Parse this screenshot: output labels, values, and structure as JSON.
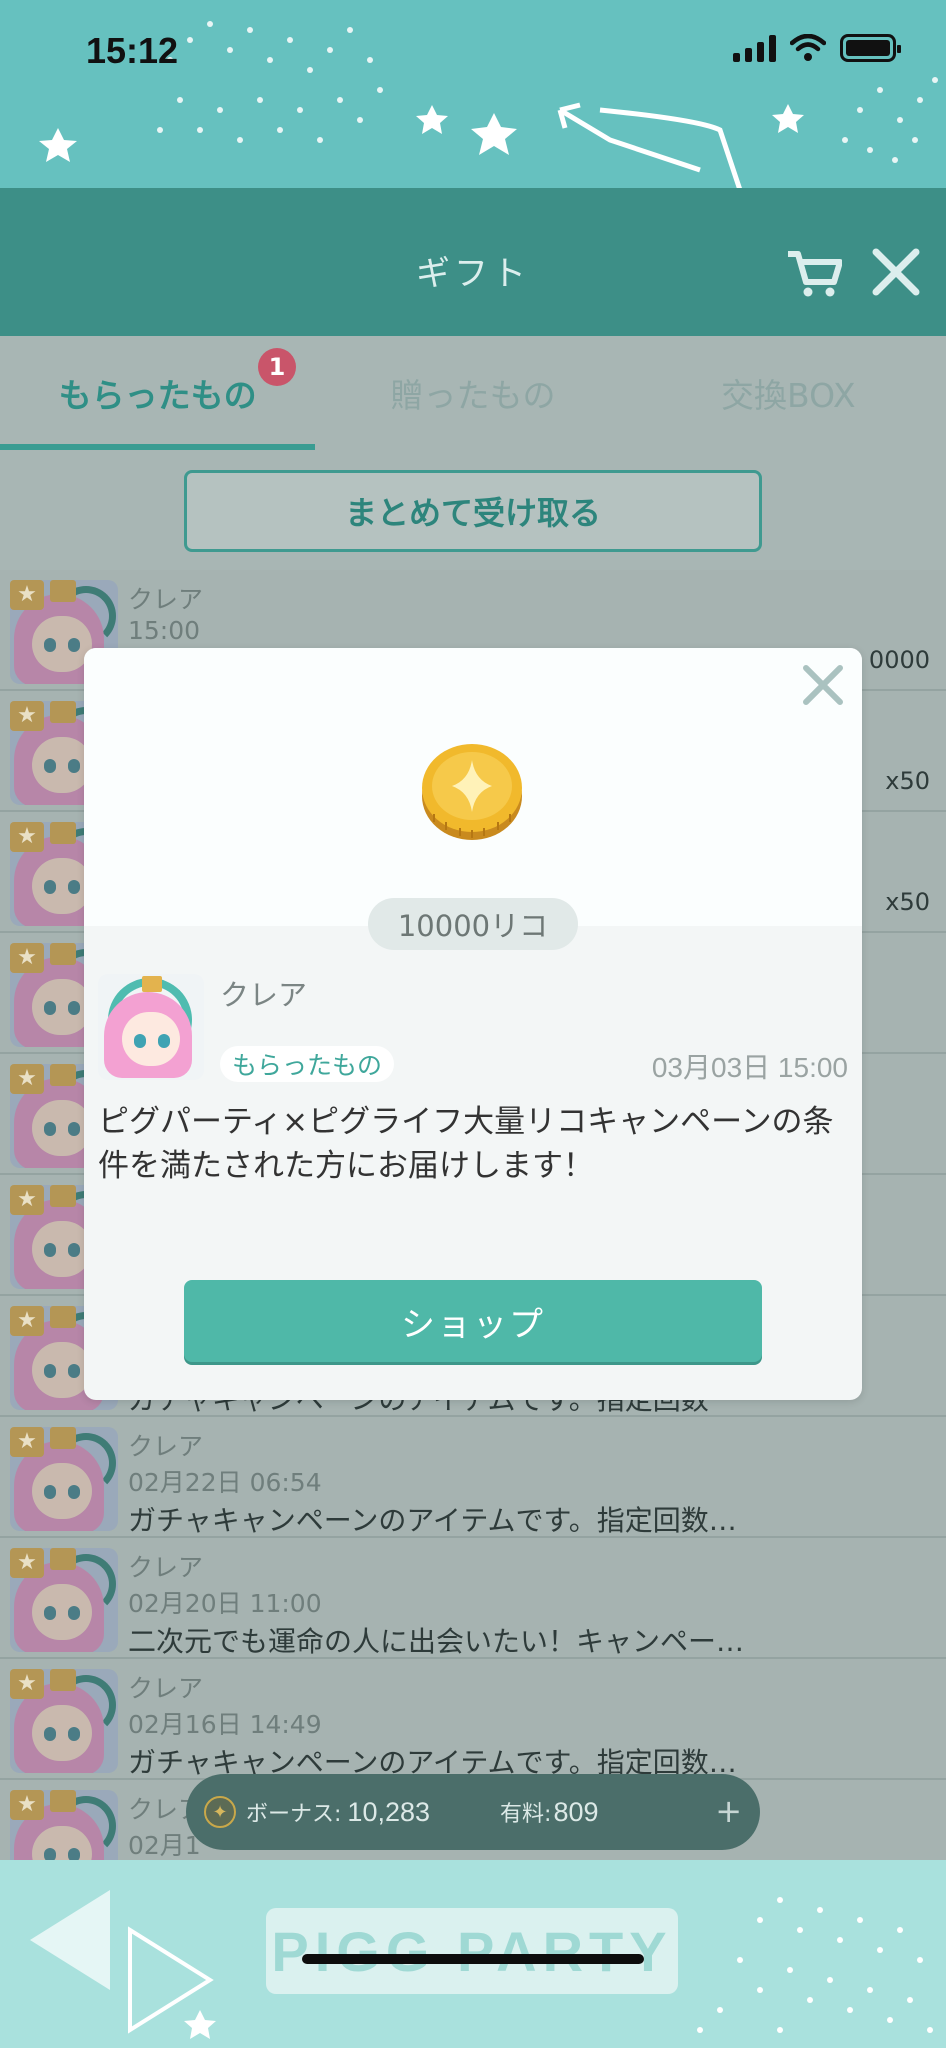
{
  "status_bar": {
    "time": "15:12"
  },
  "header": {
    "title": "ギフト",
    "cart_icon": "cart-icon",
    "close_icon": "close-icon"
  },
  "tabs": [
    {
      "label": "もらったもの",
      "active": true,
      "badge": "1"
    },
    {
      "label": "贈ったもの",
      "active": false
    },
    {
      "label": "交換BOX",
      "active": false
    }
  ],
  "receive_all_label": "まとめて受け取る",
  "list": {
    "rows": [
      {
        "sender": "クレア",
        "date": "15:00",
        "message": "",
        "qty": "0000"
      },
      {
        "sender": "",
        "date": "",
        "message": "",
        "qty": "x50"
      },
      {
        "sender": "",
        "date": "",
        "message": "",
        "qty": "x50"
      },
      {
        "sender": "",
        "date": "",
        "message": "",
        "qty": ""
      },
      {
        "sender": "",
        "date": "",
        "message": "",
        "qty": ""
      },
      {
        "sender": "",
        "date": "",
        "message": "",
        "qty": ""
      },
      {
        "sender": "",
        "date": "",
        "message": "ガチャキャンペーンのアイテムです。指定回数",
        "qty": ""
      },
      {
        "sender": "クレア",
        "date": "02月22日 06:54",
        "message": "ガチャキャンペーンのアイテムです。指定回数…",
        "qty": ""
      },
      {
        "sender": "クレア",
        "date": "02月20日 11:00",
        "message": "二次元でも運命の人に出会いたい！キャンペー…",
        "qty": ""
      },
      {
        "sender": "クレア",
        "date": "02月16日 14:49",
        "message": "ガチャキャンペーンのアイテムです。指定回数…",
        "qty": ""
      },
      {
        "sender": "クレア",
        "date": "02月1",
        "message": "",
        "qty": ""
      }
    ]
  },
  "currency": {
    "bonus_label": "ボーナス:",
    "bonus_value": "10,283",
    "paid_label": "有料:",
    "paid_value": "809",
    "add_label": "+"
  },
  "footer_logo": "PIGG PARTY",
  "modal": {
    "amount": "10000リコ",
    "sender": "クレア",
    "tag": "もらったもの",
    "date": "03月03日 15:00",
    "description": "ピグパーティ×ピグライフ大量リコキャンペーンの条件を満たされた方にお届けします！",
    "shop_button": "ショップ"
  },
  "colors": {
    "accent": "#4fb8a8",
    "header": "#3d8f87",
    "badge": "#c9556a"
  }
}
